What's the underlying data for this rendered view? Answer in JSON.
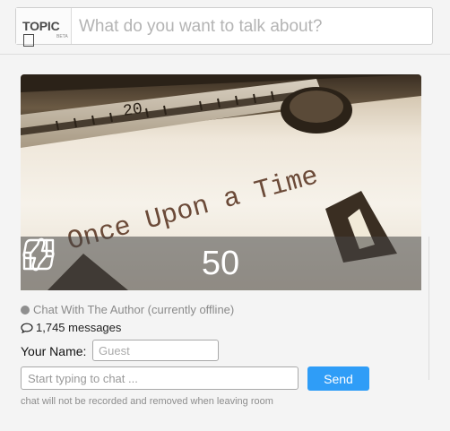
{
  "header": {
    "logo_text": "TOPIC",
    "logo_sub": "BETA",
    "search_placeholder": "What do you want to talk about?"
  },
  "topic": {
    "image_text": "Once Upon a Time",
    "typewriter_scale": "20",
    "vote_count": "50",
    "icons": {
      "upvote": "thumbs-up-icon",
      "downvote": "thumbs-down-icon"
    }
  },
  "chat": {
    "status": "Chat With The Author (currently offline)",
    "messages": "1,745 messages",
    "name_label": "Your Name:",
    "name_placeholder": "Guest",
    "chat_placeholder": "Start typing to chat ...",
    "send_label": "Send",
    "disclaimer": "chat will not be recorded and removed when leaving room"
  },
  "colors": {
    "accent": "#2f9df7",
    "status_offline": "#8f8f8f"
  }
}
